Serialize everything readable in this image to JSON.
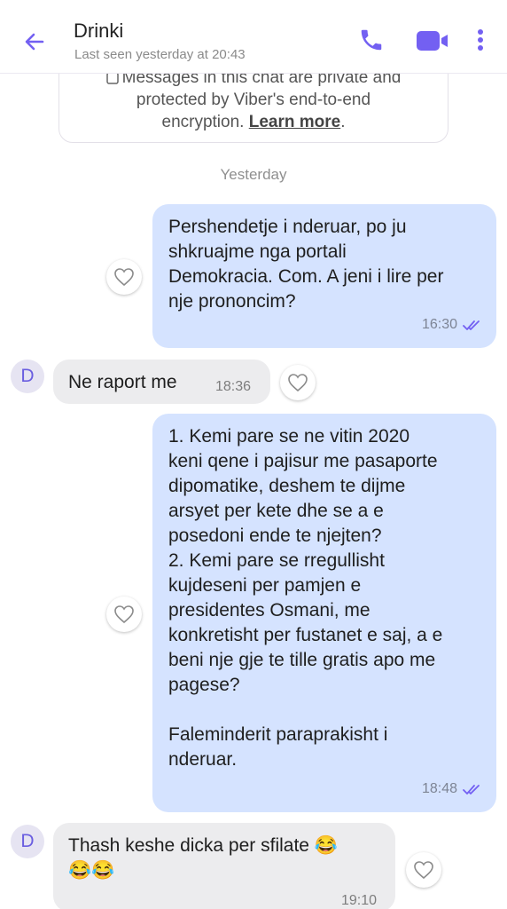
{
  "header": {
    "title": "Drinki",
    "subtitle": "Last seen yesterday at 20:43"
  },
  "encryption": {
    "line1": "Messages in this chat are private and",
    "line2": "protected by Viber's end-to-end",
    "line3_prefix": "encryption. ",
    "learn_more": "Learn more",
    "line3_suffix": "."
  },
  "date_separator": "Yesterday",
  "avatar_initial": "D",
  "messages": [
    {
      "direction": "out",
      "text": "Pershendetje i nderuar, po ju\nshkruajme nga portali\nDemokracia. Com. A jeni i lire per\nnje prononcim?",
      "time": "16:30"
    },
    {
      "direction": "in",
      "text": "Ne raport me",
      "time": "18:36"
    },
    {
      "direction": "out",
      "text": "1. Kemi pare se ne vitin 2020\nkeni qene i pajisur me pasaporte\ndipomatike, deshem te dijme\narsyet per kete dhe se a e\nposedoni ende te njejten?\n2. Kemi pare se rregullisht\nkujdeseni per pamjen e\npresidentes Osmani, me\nkonkretisht per fustanet e saj, a e\nbeni nje gje te tille gratis apo me\npagese?\n\nFaleminderit paraprakisht i\nnderuar.",
      "time": "18:48"
    },
    {
      "direction": "in",
      "text": "Thash keshe dicka per sfilate 😂\n😂😂",
      "time": "19:10"
    }
  ],
  "colors": {
    "accent": "#7360f2",
    "outgoing_bubble": "#d5e3ff",
    "incoming_bubble": "#ececee"
  },
  "icons": {
    "back": "arrow-left-icon",
    "call": "phone-icon",
    "video": "video-camera-icon",
    "more": "more-vertical-icon",
    "like": "heart-icon",
    "read": "double-check-icon"
  }
}
